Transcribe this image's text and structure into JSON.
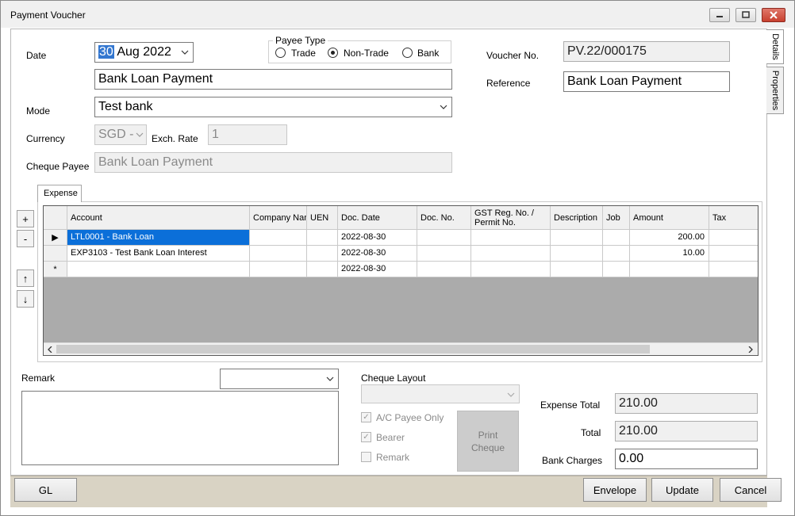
{
  "window": {
    "title": "Payment Voucher"
  },
  "side_tabs": [
    "Details",
    "Properties"
  ],
  "form": {
    "date_label": "Date",
    "date_day": "30",
    "date_rest": "Aug 2022",
    "description": "Bank Loan Payment",
    "payee_type": {
      "title": "Payee Type",
      "options": [
        "Trade",
        "Non-Trade",
        "Bank"
      ],
      "selected": "Non-Trade"
    },
    "voucher_label": "Voucher No.",
    "voucher_no": "PV.22/000175",
    "reference_label": "Reference",
    "reference": "Bank Loan Payment",
    "mode_label": "Mode",
    "mode": "Test bank",
    "currency_label": "Currency",
    "currency": "SGD -",
    "exch_label": "Exch. Rate",
    "exch_rate": "1",
    "cheque_payee_label": "Cheque Payee",
    "cheque_payee": "Bank Loan Payment"
  },
  "grid_buttons": [
    "+",
    "-",
    "↑",
    "↓"
  ],
  "expense_tab": "Expense",
  "grid": {
    "columns": [
      "Account",
      "Company Name",
      "UEN",
      "Doc. Date",
      "Doc. No.",
      "GST Reg. No. / Permit No.",
      "Description",
      "Job",
      "Amount",
      "Tax"
    ],
    "rows": [
      {
        "marker": "▶",
        "account": "LTL0001 - Bank Loan",
        "doc_date": "2022-08-30",
        "amount": "200.00"
      },
      {
        "marker": "",
        "account": "EXP3103 - Test Bank Loan Interest",
        "doc_date": "2022-08-30",
        "amount": "10.00"
      },
      {
        "marker": "*",
        "account": "",
        "doc_date": "2022-08-30",
        "amount": ""
      }
    ]
  },
  "remark_label": "Remark",
  "cheque": {
    "layout_label": "Cheque Layout",
    "ac_payee_only": "A/C Payee Only",
    "bearer": "Bearer",
    "remark": "Remark",
    "print_line1": "Print",
    "print_line2": "Cheque"
  },
  "totals": {
    "expense_total_label": "Expense Total",
    "expense_total": "210.00",
    "total_label": "Total",
    "total": "210.00",
    "bank_charges_label": "Bank Charges",
    "bank_charges": "0.00"
  },
  "footer": {
    "gl": "GL",
    "envelope": "Envelope",
    "update": "Update",
    "cancel": "Cancel"
  }
}
